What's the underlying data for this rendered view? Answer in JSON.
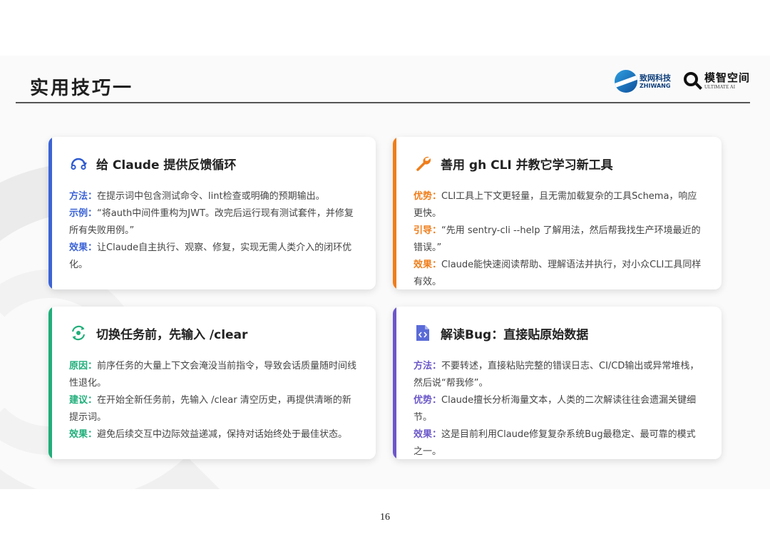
{
  "title": "实用技巧一",
  "logos": {
    "zhiwang_cn": "致网科技",
    "zhiwang_en": "ZHIWANG",
    "mozhi_cn": "模智空间",
    "mozhi_en": "ULTIMATE AI"
  },
  "colors": {
    "blue": "#3b63d6",
    "orange": "#ef7d1a",
    "green": "#1fae7a",
    "purple": "#6b57c9"
  },
  "cards": [
    {
      "icon": "feedback-loop-icon",
      "title": "给 Claude 提供反馈循环",
      "items": [
        {
          "label": "方法：",
          "text": "在提示词中包含测试命令、lint检查或明确的预期输出。"
        },
        {
          "label": "示例：",
          "text": "“将auth中间件重构为JWT。改完后运行现有测试套件，并修复所有失败用例。”"
        },
        {
          "label": "效果：",
          "text": "让Claude自主执行、观察、修复，实现无需人类介入的闭环优化。"
        }
      ]
    },
    {
      "icon": "wrench-icon",
      "title": "善用 gh CLI 并教它学习新工具",
      "items": [
        {
          "label": "优势：",
          "text": "CLI工具上下文更轻量，且无需加载复杂的工具Schema，响应更快。"
        },
        {
          "label": "引导：",
          "text": "“先用 sentry-cli --help 了解用法，然后帮我找生产环境最近的错误。”"
        },
        {
          "label": "效果：",
          "text": "Claude能快速阅读帮助、理解语法并执行，对小众CLI工具同样有效。"
        }
      ]
    },
    {
      "icon": "refresh-eye-icon",
      "title": "切换任务前，先输入 /clear",
      "items": [
        {
          "label": "原因：",
          "text": "前序任务的大量上下文会淹没当前指令，导致会话质量随时间线性退化。"
        },
        {
          "label": "建议：",
          "text": "在开始全新任务前，先输入 /clear 清空历史，再提供清晰的新提示词。"
        },
        {
          "label": "效果：",
          "text": "避免后续交互中边际效益递减，保持对话始终处于最佳状态。"
        }
      ]
    },
    {
      "icon": "code-file-icon",
      "title": "解读Bug：直接贴原始数据",
      "items": [
        {
          "label": "方法：",
          "text": "不要转述，直接粘贴完整的错误日志、CI/CD输出或异常堆栈，然后说“帮我修”。"
        },
        {
          "label": "优势：",
          "text": "Claude擅长分析海量文本，人类的二次解读往往会遗漏关键细节。"
        },
        {
          "label": "效果：",
          "text": "这是目前利用Claude修复复杂系统Bug最稳定、最可靠的模式之一。"
        }
      ]
    }
  ],
  "page_number": "16"
}
